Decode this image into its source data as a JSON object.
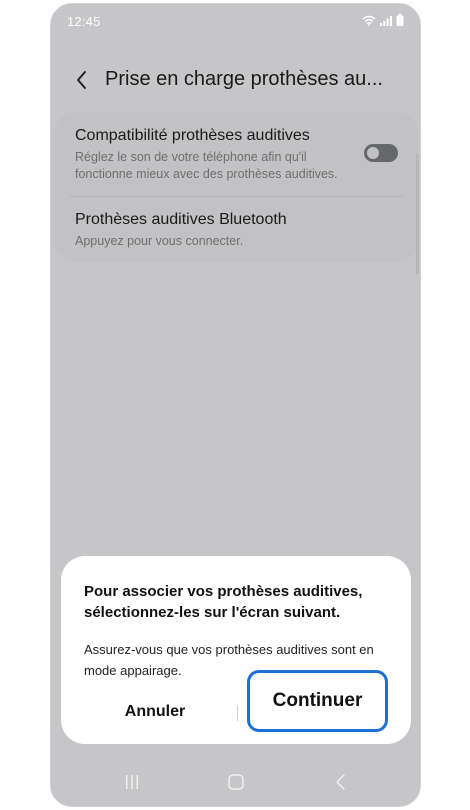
{
  "status_bar": {
    "time": "12:45",
    "icons": [
      "wifi-icon",
      "signal-icon",
      "battery-icon"
    ]
  },
  "header": {
    "back_icon": "chevron-left-icon",
    "title": "Prise en charge prothèses au..."
  },
  "settings": {
    "items": [
      {
        "title": "Compatibilité prothèses auditives",
        "description": "Réglez le son de votre téléphone afin qu'il fonctionne mieux avec des prothèses auditives.",
        "toggle_on": false
      },
      {
        "title": "Prothèses auditives Bluetooth",
        "description": "Appuyez pour vous connecter."
      }
    ]
  },
  "dialog": {
    "title": "Pour associer vos prothèses auditives, sélectionnez-les sur l'écran suivant.",
    "message": "Assurez-vous que vos prothèses auditives sont en mode appairage.",
    "cancel_label": "Annuler",
    "continue_label": "Continuer"
  },
  "nav_bar": {
    "icons": [
      "recent-apps-icon",
      "home-icon",
      "back-icon"
    ]
  },
  "colors": {
    "dimmed_background": "#c6c6c8",
    "highlight": "#1d6fd1",
    "dialog_background": "#ffffff"
  }
}
